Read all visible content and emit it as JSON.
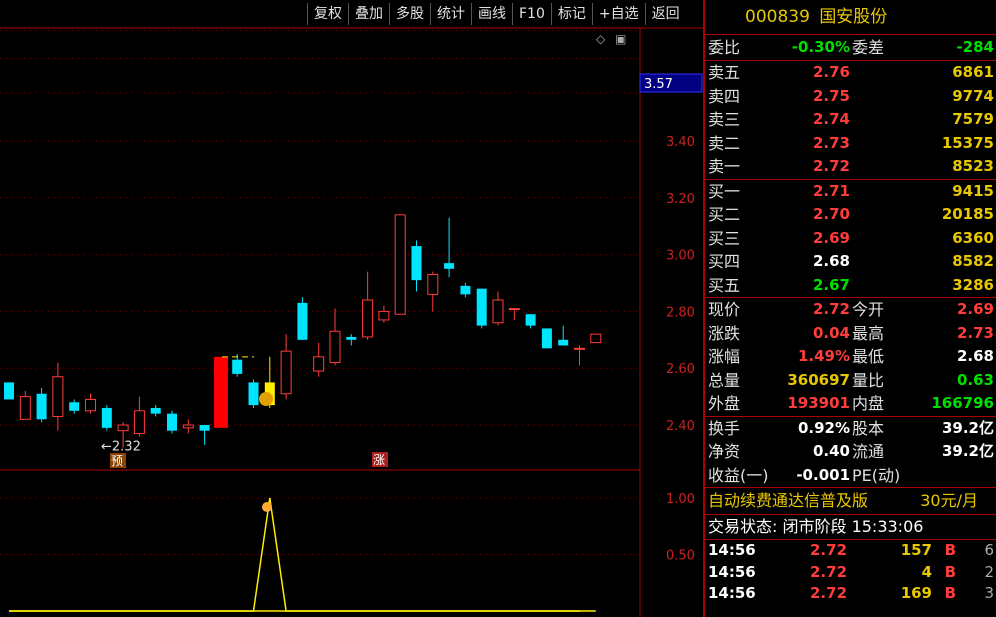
{
  "toolbar": {
    "buttons": [
      "复权",
      "叠加",
      "多股",
      "统计",
      "画线",
      "F10",
      "标记",
      "+自选",
      "返回"
    ]
  },
  "chart": {
    "price_label": "3.57",
    "low_marker": "←2.32",
    "badge_yu": "预",
    "badge_zhang": "涨"
  },
  "chart_data": {
    "type": "candlestick",
    "y_ticks": [
      "3.40",
      "3.20",
      "3.00",
      "2.80",
      "2.60",
      "2.40"
    ],
    "y_tick_values": [
      3.4,
      3.2,
      3.0,
      2.8,
      2.6,
      2.4
    ],
    "lower_y_ticks": [
      "1.00",
      "0.50"
    ],
    "lower_y_values": [
      1.0,
      0.5
    ],
    "candles": [
      {
        "o": 2.55,
        "c": 2.49,
        "h": 2.55,
        "l": 2.49
      },
      {
        "o": 2.42,
        "c": 2.5,
        "h": 2.52,
        "l": 2.42
      },
      {
        "o": 2.51,
        "c": 2.42,
        "h": 2.53,
        "l": 2.41
      },
      {
        "o": 2.43,
        "c": 2.57,
        "h": 2.62,
        "l": 2.38
      },
      {
        "o": 2.48,
        "c": 2.45,
        "h": 2.49,
        "l": 2.44
      },
      {
        "o": 2.45,
        "c": 2.49,
        "h": 2.51,
        "l": 2.44
      },
      {
        "o": 2.46,
        "c": 2.39,
        "h": 2.47,
        "l": 2.38
      },
      {
        "o": 2.38,
        "c": 2.4,
        "h": 2.41,
        "l": 2.32
      },
      {
        "o": 2.37,
        "c": 2.45,
        "h": 2.5,
        "l": 2.36
      },
      {
        "o": 2.46,
        "c": 2.44,
        "h": 2.47,
        "l": 2.43
      },
      {
        "o": 2.44,
        "c": 2.38,
        "h": 2.45,
        "l": 2.37
      },
      {
        "o": 2.39,
        "c": 2.4,
        "h": 2.42,
        "l": 2.37
      },
      {
        "o": 2.4,
        "c": 2.38,
        "h": 2.4,
        "l": 2.33
      },
      {
        "o": 2.39,
        "c": 2.64,
        "h": 2.64,
        "l": 2.39
      },
      {
        "o": 2.63,
        "c": 2.58,
        "h": 2.65,
        "l": 2.57
      },
      {
        "o": 2.55,
        "c": 2.47,
        "h": 2.56,
        "l": 2.46
      },
      {
        "o": 2.47,
        "c": 2.55,
        "h": 2.64,
        "l": 2.46
      },
      {
        "o": 2.51,
        "c": 2.66,
        "h": 2.72,
        "l": 2.49
      },
      {
        "o": 2.83,
        "c": 2.7,
        "h": 2.85,
        "l": 2.7
      },
      {
        "o": 2.59,
        "c": 2.64,
        "h": 2.69,
        "l": 2.57
      },
      {
        "o": 2.62,
        "c": 2.73,
        "h": 2.81,
        "l": 2.61
      },
      {
        "o": 2.71,
        "c": 2.7,
        "h": 2.72,
        "l": 2.68
      },
      {
        "o": 2.71,
        "c": 2.84,
        "h": 2.94,
        "l": 2.7
      },
      {
        "o": 2.77,
        "c": 2.8,
        "h": 2.82,
        "l": 2.76
      },
      {
        "o": 2.79,
        "c": 3.14,
        "h": 3.14,
        "l": 2.79
      },
      {
        "o": 3.03,
        "c": 2.91,
        "h": 3.05,
        "l": 2.87
      },
      {
        "o": 2.86,
        "c": 2.93,
        "h": 2.94,
        "l": 2.8
      },
      {
        "o": 2.97,
        "c": 2.95,
        "h": 3.13,
        "l": 2.92
      },
      {
        "o": 2.89,
        "c": 2.86,
        "h": 2.9,
        "l": 2.85
      },
      {
        "o": 2.88,
        "c": 2.75,
        "h": 2.88,
        "l": 2.74
      },
      {
        "o": 2.76,
        "c": 2.84,
        "h": 2.87,
        "l": 2.75
      },
      {
        "o": 2.81,
        "c": 2.81,
        "h": 2.81,
        "l": 2.77
      },
      {
        "o": 2.79,
        "c": 2.75,
        "h": 2.79,
        "l": 2.74
      },
      {
        "o": 2.74,
        "c": 2.67,
        "h": 2.74,
        "l": 2.67
      },
      {
        "o": 2.7,
        "c": 2.68,
        "h": 2.75,
        "l": 2.68
      },
      {
        "o": 2.67,
        "c": 2.67,
        "h": 2.68,
        "l": 2.61
      },
      {
        "o": 2.69,
        "c": 2.72,
        "h": 2.72,
        "l": 2.69
      }
    ],
    "indicator_values": [
      0,
      0,
      0,
      0,
      0,
      0,
      0,
      0,
      0,
      0,
      0,
      0,
      0,
      0,
      0,
      0,
      1.0,
      0,
      0,
      0,
      0,
      0,
      0,
      0,
      0,
      0,
      0,
      0,
      0,
      0,
      0,
      0,
      0,
      0,
      0,
      0,
      0
    ]
  },
  "panel": {
    "code": "000839",
    "name": "国安股份",
    "wei_bi_label": "委比",
    "wei_bi": "-0.30%",
    "wei_cha_label": "委差",
    "wei_cha": "-284",
    "sell": [
      {
        "label": "卖五",
        "price": "2.76",
        "vol": "6861",
        "color": "red"
      },
      {
        "label": "卖四",
        "price": "2.75",
        "vol": "9774",
        "color": "red"
      },
      {
        "label": "卖三",
        "price": "2.74",
        "vol": "7579",
        "color": "red"
      },
      {
        "label": "卖二",
        "price": "2.73",
        "vol": "15375",
        "color": "red"
      },
      {
        "label": "卖一",
        "price": "2.72",
        "vol": "8523",
        "color": "red"
      }
    ],
    "buy": [
      {
        "label": "买一",
        "price": "2.71",
        "vol": "9415",
        "color": "red"
      },
      {
        "label": "买二",
        "price": "2.70",
        "vol": "20185",
        "color": "red"
      },
      {
        "label": "买三",
        "price": "2.69",
        "vol": "6360",
        "color": "red"
      },
      {
        "label": "买四",
        "price": "2.68",
        "vol": "8582",
        "color": "white"
      },
      {
        "label": "买五",
        "price": "2.67",
        "vol": "3286",
        "color": "green"
      }
    ],
    "quote": [
      {
        "l1": "现价",
        "v1": "2.72",
        "c1": "red",
        "l2": "今开",
        "v2": "2.69",
        "c2": "red"
      },
      {
        "l1": "涨跌",
        "v1": "0.04",
        "c1": "red",
        "l2": "最高",
        "v2": "2.73",
        "c2": "red"
      },
      {
        "l1": "涨幅",
        "v1": "1.49%",
        "c1": "red",
        "l2": "最低",
        "v2": "2.68",
        "c2": "white"
      },
      {
        "l1": "总量",
        "v1": "360697",
        "c1": "yellow",
        "l2": "量比",
        "v2": "0.63",
        "c2": "green"
      },
      {
        "l1": "外盘",
        "v1": "193901",
        "c1": "red",
        "l2": "内盘",
        "v2": "166796",
        "c2": "green"
      }
    ],
    "fin": [
      {
        "l1": "换手",
        "v1": "0.92%",
        "l2": "股本",
        "v2": "39.2亿"
      },
      {
        "l1": "净资",
        "v1": "0.40",
        "l2": "流通",
        "v2": "39.2亿"
      },
      {
        "l1": "收益(一)",
        "v1": "-0.001",
        "l2": "PE(动)",
        "v2": ""
      }
    ],
    "ad_text": "自动续费通达信普及版",
    "ad_price": "30元/月",
    "status": "交易状态: 闭市阶段 15:33:06",
    "ticks": [
      {
        "time": "14:56",
        "price": "2.72",
        "vol": "157",
        "bs": "B",
        "cnt": "6"
      },
      {
        "time": "14:56",
        "price": "2.72",
        "vol": "4",
        "bs": "B",
        "cnt": "2"
      },
      {
        "time": "14:56",
        "price": "2.72",
        "vol": "169",
        "bs": "B",
        "cnt": "3"
      }
    ]
  }
}
